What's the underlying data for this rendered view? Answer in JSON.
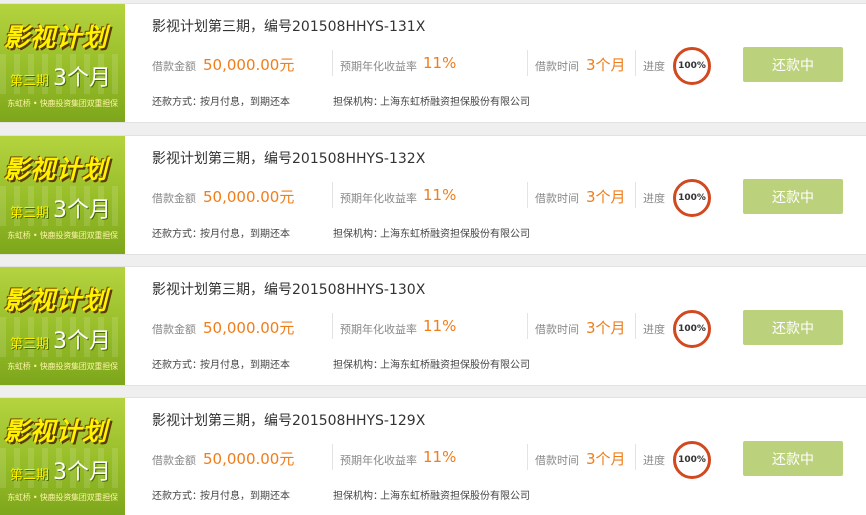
{
  "thumbnail": {
    "title": "影视计划",
    "term_prefix": "第三期",
    "term_big": "3个月",
    "subtitle": "东虹桥 • 快鹿投资集团双重担保"
  },
  "labels": {
    "amount": "借款金额",
    "rate": "预期年化收益率",
    "duration": "借款时间",
    "progress": "进度",
    "repay_method_label": "还款方式：",
    "guarantor_label": "担保机构："
  },
  "loans": [
    {
      "title": "影视计划第三期，编号201508HHYS-131X",
      "amount": "50,000.00元",
      "rate": "11%",
      "duration": "3个月",
      "progress": "100%",
      "repay_method": "按月付息，到期还本",
      "guarantor": "上海东虹桥融资担保股份有限公司",
      "button": "还款中"
    },
    {
      "title": "影视计划第三期，编号201508HHYS-132X",
      "amount": "50,000.00元",
      "rate": "11%",
      "duration": "3个月",
      "progress": "100%",
      "repay_method": "按月付息，到期还本",
      "guarantor": "上海东虹桥融资担保股份有限公司",
      "button": "还款中"
    },
    {
      "title": "影视计划第三期，编号201508HHYS-130X",
      "amount": "50,000.00元",
      "rate": "11%",
      "duration": "3个月",
      "progress": "100%",
      "repay_method": "按月付息，到期还本",
      "guarantor": "上海东虹桥融资担保股份有限公司",
      "button": "还款中"
    },
    {
      "title": "影视计划第三期，编号201508HHYS-129X",
      "amount": "50,000.00元",
      "rate": "11%",
      "duration": "3个月",
      "progress": "100%",
      "repay_method": "按月付息，到期还本",
      "guarantor": "上海东虹桥融资担保股份有限公司",
      "button": "还款中"
    }
  ],
  "colors": {
    "accent_orange": "#f07d1a",
    "progress_ring": "#d2481f",
    "button_bg": "#bcd17b",
    "thumb_green": "#9cc22c"
  }
}
